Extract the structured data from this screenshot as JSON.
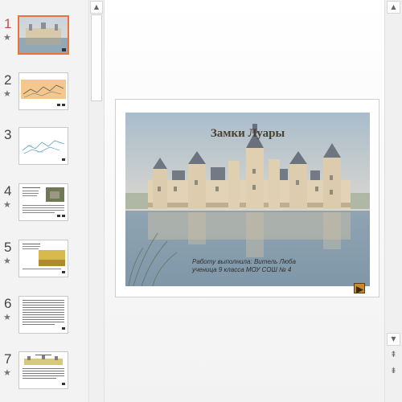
{
  "thumbnails": [
    {
      "number": "1",
      "has_animation_icon": "star-icon",
      "selected": true
    },
    {
      "number": "2",
      "has_animation_icon": "star-icon",
      "selected": false
    },
    {
      "number": "3",
      "has_animation_icon": "",
      "selected": false
    },
    {
      "number": "4",
      "has_animation_icon": "star-icon",
      "selected": false
    },
    {
      "number": "5",
      "has_animation_icon": "star-icon",
      "selected": false
    },
    {
      "number": "6",
      "has_animation_icon": "star-icon",
      "selected": false
    },
    {
      "number": "7",
      "has_animation_icon": "star-icon",
      "selected": false
    }
  ],
  "star_glyph": "★",
  "slide": {
    "title": "Замки Луары",
    "author_line_1": "Работу выполнила: Витель Люба",
    "author_line_2": "ученица 9 класса МОУ СОШ № 4"
  },
  "icons": {
    "up": "▲",
    "down": "▼",
    "prev_slide": "⇞",
    "next_slide": "⇟"
  },
  "colors": {
    "selected_thumb_border": "#e8743b",
    "selected_number": "#c0504d",
    "slide_title": "#4a4032"
  }
}
